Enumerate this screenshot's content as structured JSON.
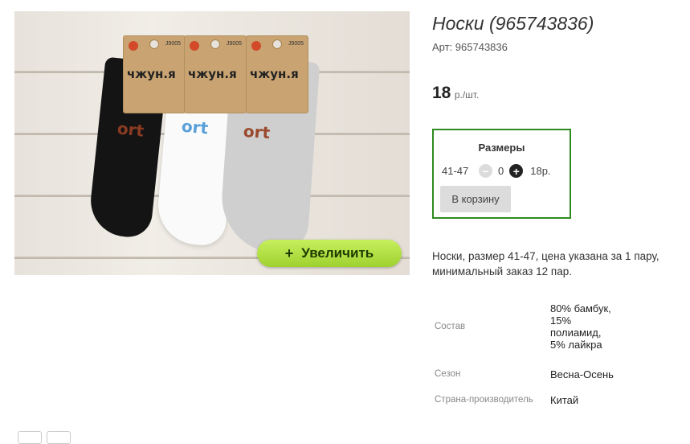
{
  "product": {
    "title": "Носки (965743836)",
    "article": "Арт: 965743836",
    "price_value": "18",
    "price_unit": "р./шт."
  },
  "photo": {
    "tag_brand": "чжун.я",
    "tag_codes": [
      "J9005",
      "J9005",
      "J9005"
    ],
    "sock_text": "ort",
    "zoom_label": "Увеличить",
    "zoom_icon": "plus-icon"
  },
  "sizes": {
    "title": "Размеры",
    "row": {
      "size": "41-47",
      "quantity": "0",
      "price": "18р."
    },
    "minus_icon": "minus-circle-icon",
    "plus_icon": "plus-circle-icon",
    "cart_label": "В корзину"
  },
  "description": "Носки, размер 41-47, цена указана за 1 пару, минимальный заказ 12 пар.",
  "specs": [
    {
      "key": "Состав",
      "value": "80% бамбук, 15% полиамид, 5% лайкра"
    },
    {
      "key": "Сезон",
      "value": "Весна-Осень"
    },
    {
      "key": "Страна-производитель",
      "value": "Китай"
    }
  ],
  "colors": {
    "accent_border": "#2e8b1e",
    "zoom_button": "#b5e245"
  }
}
